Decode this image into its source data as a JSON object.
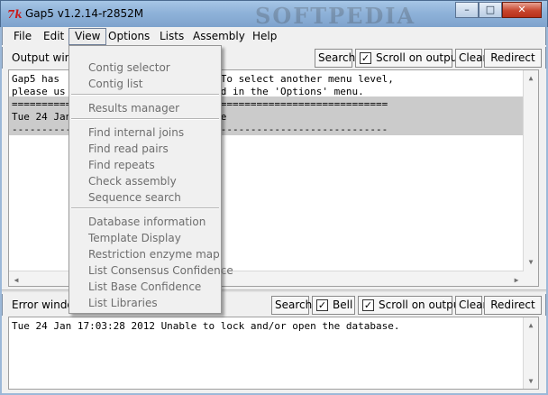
{
  "window": {
    "title": "Gap5 v1.2.14-r2852M",
    "icon_glyph": "7k",
    "watermark": "SOFTPEDIA",
    "minimize": "–",
    "maximize": "□",
    "close": "✕"
  },
  "menubar": {
    "items": [
      {
        "label": "File"
      },
      {
        "label": "Edit"
      },
      {
        "label": "View"
      },
      {
        "label": "Options"
      },
      {
        "label": "Lists"
      },
      {
        "label": "Assembly"
      },
      {
        "label": "Help"
      }
    ]
  },
  "output": {
    "label": "Output windo",
    "search": "Search",
    "scroll_label": "Scroll on output",
    "scroll_checked": "✓",
    "clear": "Clear",
    "redirect": "Redirect >>",
    "lines": [
      "Gap5 has                     mode. To select another menu level,",
      "please us                    command in the 'Options' menu.",
      "==========                   ==================================",
      "Tue 24 Jan                   atabase",
      "----------                   ----------------------------------"
    ]
  },
  "errors": {
    "label": "Error window",
    "search": "Search",
    "bell_label": "Bell",
    "bell_checked": "✓",
    "scroll_label": "Scroll on output",
    "scroll_checked": "✓",
    "clear": "Clear",
    "redirect": "Redirect >>",
    "lines": [
      "Tue 24 Jan 17:03:28 2012 Unable to lock and/or open the database."
    ]
  },
  "view_menu": {
    "group1": [
      "Contig selector",
      "Contig list"
    ],
    "group2": [
      "Results manager"
    ],
    "group3": [
      "Find internal joins",
      "Find read pairs",
      "Find repeats",
      "Check assembly",
      "Sequence search"
    ],
    "group4": [
      "Database information",
      "Template Display",
      "Restriction enzyme map",
      "List Consensus Confidence",
      "List Base Confidence",
      "List Libraries"
    ]
  },
  "colors": {
    "titlebar": "#8fb2d9",
    "highlight_band": "#cbcbcb",
    "disabled_text": "#6d6d6d"
  }
}
